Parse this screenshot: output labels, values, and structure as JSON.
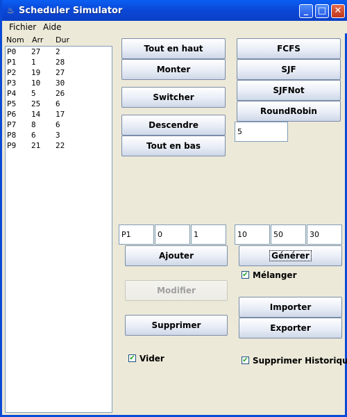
{
  "window": {
    "title": "Scheduler Simulator",
    "icon": "java-cup-icon"
  },
  "menu": [
    "Fichier",
    "Aide"
  ],
  "process_table": {
    "columns": [
      "Nom",
      "Arr",
      "Dur"
    ],
    "rows": [
      [
        "P0",
        "27",
        "2"
      ],
      [
        "P1",
        "1",
        "28"
      ],
      [
        "P2",
        "19",
        "27"
      ],
      [
        "P3",
        "10",
        "30"
      ],
      [
        "P4",
        "5",
        "26"
      ],
      [
        "P5",
        "25",
        "6"
      ],
      [
        "P6",
        "14",
        "17"
      ],
      [
        "P7",
        "8",
        "6"
      ],
      [
        "P8",
        "6",
        "3"
      ],
      [
        "P9",
        "21",
        "22"
      ]
    ]
  },
  "order_buttons": {
    "tout_en_haut": "Tout en haut",
    "monter": "Monter",
    "switcher": "Switcher",
    "descendre": "Descendre",
    "tout_en_bas": "Tout en bas"
  },
  "algorithms": {
    "fcfs": "FCFS",
    "sjf": "SJF",
    "sjfnot": "SJFNot",
    "roundrobin": "RoundRobin",
    "quantum": "5"
  },
  "process_editor": {
    "name": "P1",
    "arrival": "0",
    "duration": "1",
    "ajouter": "Ajouter",
    "modifier": "Modifier",
    "supprimer": "Supprimer",
    "vider": "Vider",
    "vider_checked": true
  },
  "generator": {
    "count": "10",
    "max_arrival": "50",
    "max_duration": "30",
    "generer": "Générer",
    "melanger": "Mélanger",
    "melanger_checked": true,
    "importer": "Importer",
    "exporter": "Exporter",
    "supprimer_historique": "Supprimer Historique",
    "supprimer_historique_checked": true
  },
  "colors": {
    "titlebar": "#0a47d6",
    "window_bg": "#ece9d8",
    "check_mark": "#21a121"
  }
}
